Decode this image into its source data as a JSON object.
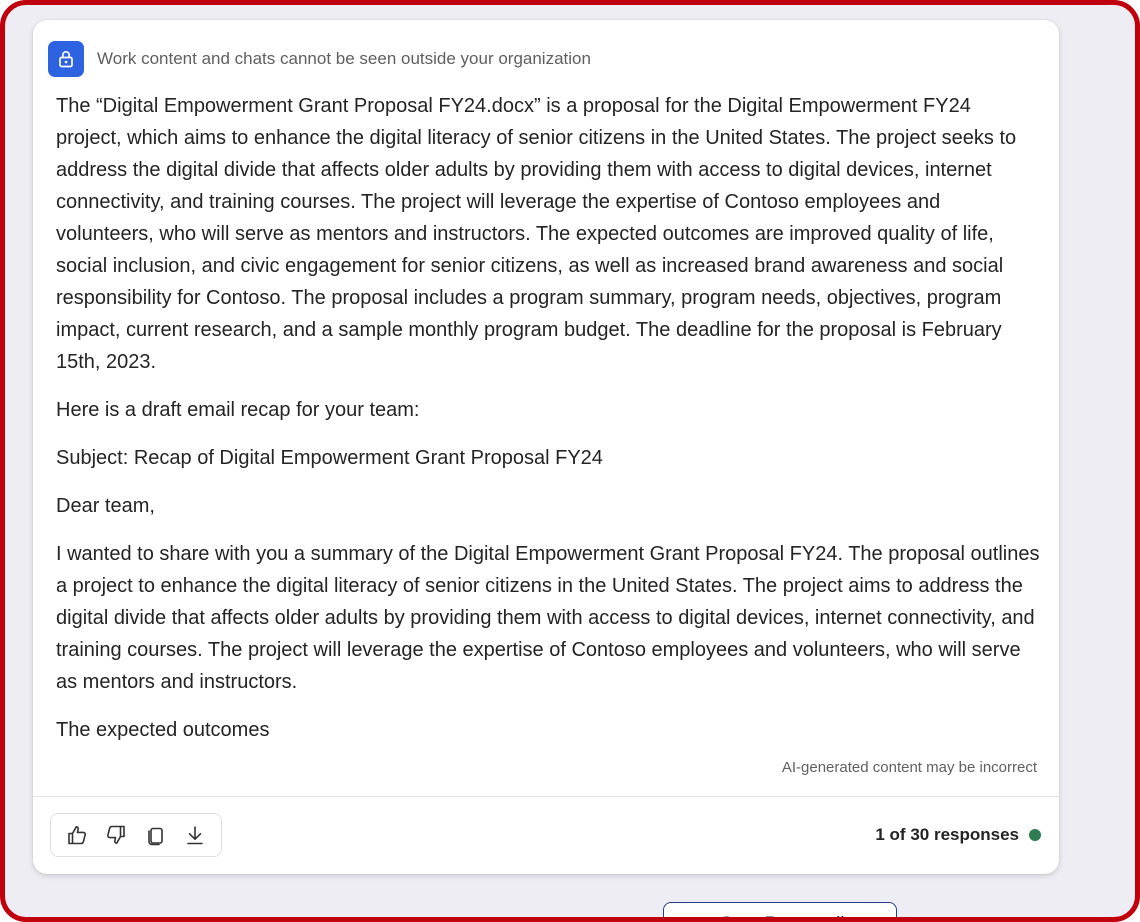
{
  "notice": {
    "icon": "lock-icon",
    "text": "Work content and chats cannot be seen outside your organization"
  },
  "response": {
    "paragraphs": [
      "The “Digital Empowerment Grant Proposal FY24.docx” is a proposal for the Digital Empowerment FY24 project, which aims to enhance the digital literacy of senior citizens in the United States. The project seeks to address the digital divide that affects older adults by providing them with access to digital devices, internet connectivity, and training courses. The project will leverage the expertise of Contoso employees and volunteers, who will serve as mentors and instructors. The expected outcomes are improved quality of life, social inclusion, and civic engagement for senior citizens, as well as increased brand awareness and social responsibility for Contoso. The proposal includes a program summary, program needs, objectives, program impact, current research, and a sample monthly program budget. The deadline for the proposal is February 15th, 2023.",
      "Here is a draft email recap for your team:",
      "Subject: Recap of Digital Empowerment Grant Proposal FY24",
      "Dear team,",
      "I wanted to share with you a summary of the Digital Empowerment Grant Proposal FY24. The proposal outlines a project to enhance the digital literacy of senior citizens in the United States. The project aims to address the digital divide that affects older adults by providing them with access to digital devices, internet connectivity, and training courses. The project will leverage the expertise of Contoso employees and volunteers, who will serve as mentors and instructors.",
      "The expected outcomes"
    ],
    "ai_disclaimer": "AI-generated content may be incorrect"
  },
  "actions": [
    {
      "icon": "thumbs-up-icon"
    },
    {
      "icon": "thumbs-down-icon"
    },
    {
      "icon": "copy-icon"
    },
    {
      "icon": "download-icon"
    }
  ],
  "response_counter": "1 of 30 responses",
  "stop_button": {
    "label": "Stop Responding"
  },
  "colors": {
    "frame_border": "#c0000c",
    "accent": "#2d63e1",
    "status_dot": "#2e7d52",
    "background": "#eeedf3"
  }
}
